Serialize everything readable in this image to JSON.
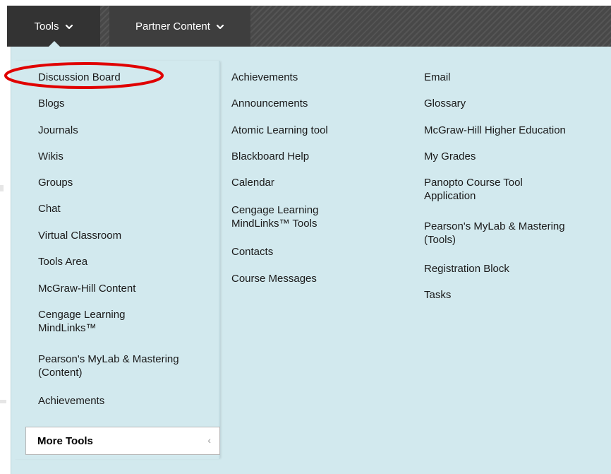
{
  "nav": {
    "tabs": [
      {
        "label": "Tools"
      },
      {
        "label": "Partner Content"
      }
    ]
  },
  "columns": {
    "left": [
      {
        "label": "Discussion Board"
      },
      {
        "label": "Blogs"
      },
      {
        "label": "Journals"
      },
      {
        "label": "Wikis"
      },
      {
        "label": "Groups"
      },
      {
        "label": "Chat"
      },
      {
        "label": "Virtual Classroom"
      },
      {
        "label": "Tools Area"
      },
      {
        "label": "McGraw-Hill Content"
      },
      {
        "label_line1": "Cengage Learning",
        "label_line2": "MindLinks™"
      },
      {
        "label_line1": "Pearson's MyLab & Mastering",
        "label_line2": "(Content)"
      },
      {
        "label": "Achievements"
      }
    ],
    "middle": [
      {
        "label": "Achievements"
      },
      {
        "label": "Announcements"
      },
      {
        "label": "Atomic Learning tool"
      },
      {
        "label": "Blackboard Help"
      },
      {
        "label": "Calendar"
      },
      {
        "label_line1": "Cengage Learning",
        "label_line2": "MindLinks™ Tools"
      },
      {
        "label": "Contacts"
      },
      {
        "label": "Course Messages"
      }
    ],
    "right": [
      {
        "label": "Email"
      },
      {
        "label": "Glossary"
      },
      {
        "label": "McGraw-Hill Higher Education"
      },
      {
        "label": "My Grades"
      },
      {
        "label_line1": "Panopto Course Tool",
        "label_line2": "Application"
      },
      {
        "label_line1": "Pearson's MyLab & Mastering",
        "label_line2": "(Tools)"
      },
      {
        "label": "Registration Block"
      },
      {
        "label": "Tasks"
      }
    ]
  },
  "more_tools": {
    "label": "More Tools",
    "arrow": "‹"
  },
  "annotation": {
    "color": "#e00000"
  },
  "colors": {
    "panel": "#d2e9ee",
    "topbar": "#4d4d4d",
    "active_tab": "#333333"
  }
}
